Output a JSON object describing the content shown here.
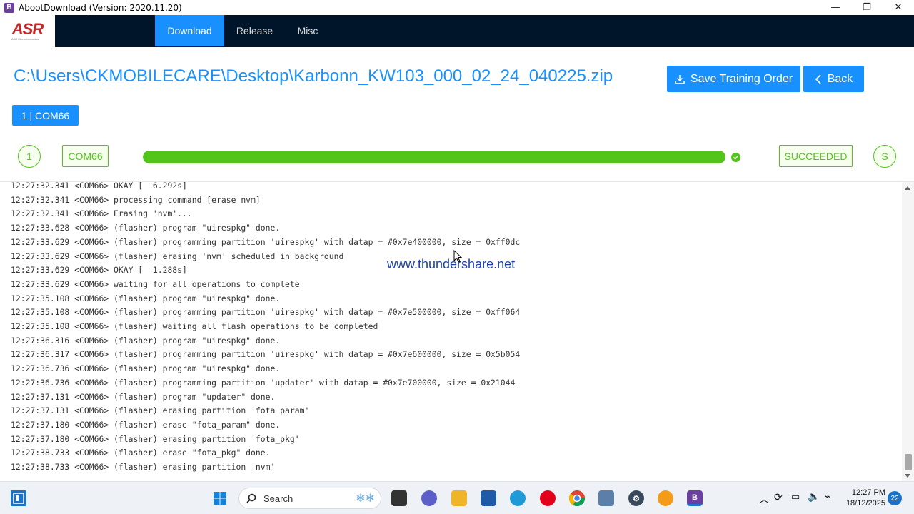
{
  "window": {
    "title": "AbootDownload (Version: 2020.11.20)",
    "minimize": "—",
    "maximize": "❐",
    "close": "✕"
  },
  "logo": {
    "text": "ASR",
    "tagline": "ASR Microelectronics"
  },
  "nav": {
    "items": [
      {
        "label": "Download",
        "active": true
      },
      {
        "label": "Release",
        "active": false
      },
      {
        "label": "Misc",
        "active": false
      }
    ]
  },
  "header": {
    "path": "C:\\Users\\CKMOBILECARE\\Desktop\\Karbonn_KW103_000_02_24_040225.zip",
    "save_button": "Save Training Order",
    "back_button": "Back"
  },
  "port_tab": {
    "label": "1 | COM66"
  },
  "progress_row": {
    "index": "1",
    "port": "COM66",
    "percent": 100,
    "status": "SUCCEEDED",
    "status_short": "S",
    "accent": "#52c41a"
  },
  "log": {
    "lines": [
      "12:27:32.341 <COM66> OKAY [  6.292s]",
      "12:27:32.341 <COM66> processing command [erase nvm]",
      "12:27:32.341 <COM66> Erasing 'nvm'...",
      "12:27:33.628 <COM66> (flasher) program \"uirespkg\" done.",
      "12:27:33.629 <COM66> (flasher) programming partition 'uirespkg' with datap = #0x7e400000, size = 0xff0dc",
      "12:27:33.629 <COM66> (flasher) erasing 'nvm' scheduled in background",
      "12:27:33.629 <COM66> OKAY [  1.288s]",
      "12:27:33.629 <COM66> waiting for all operations to complete",
      "12:27:35.108 <COM66> (flasher) program \"uirespkg\" done.",
      "12:27:35.108 <COM66> (flasher) programming partition 'uirespkg' with datap = #0x7e500000, size = 0xff064",
      "12:27:35.108 <COM66> (flasher) waiting all flash operations to be completed",
      "12:27:36.316 <COM66> (flasher) program \"uirespkg\" done.",
      "12:27:36.317 <COM66> (flasher) programming partition 'uirespkg' with datap = #0x7e600000, size = 0x5b054",
      "12:27:36.736 <COM66> (flasher) program \"uirespkg\" done.",
      "12:27:36.736 <COM66> (flasher) programming partition 'updater' with datap = #0x7e700000, size = 0x21044",
      "12:27:37.131 <COM66> (flasher) program \"updater\" done.",
      "12:27:37.131 <COM66> (flasher) erasing partition 'fota_param'",
      "12:27:37.180 <COM66> (flasher) erase \"fota_param\" done.",
      "12:27:37.180 <COM66> (flasher) erasing partition 'fota_pkg'",
      "12:27:38.733 <COM66> (flasher) erase \"fota_pkg\" done.",
      "12:27:38.733 <COM66> (flasher) erasing partition 'nvm'"
    ]
  },
  "watermark": "www.thundershare.net",
  "taskbar": {
    "search_placeholder": "Search",
    "time": "12:27 PM",
    "date": "18/12/2025",
    "notifications": "22"
  }
}
